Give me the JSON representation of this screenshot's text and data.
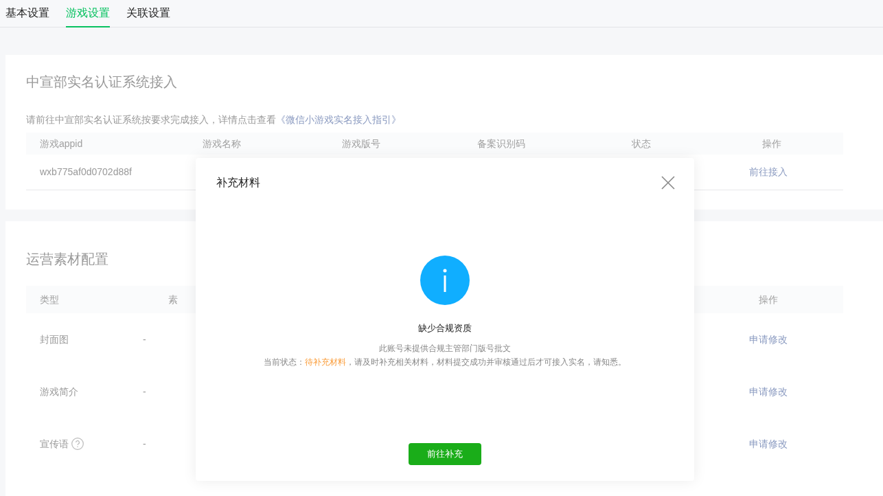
{
  "tabs": [
    {
      "label": "基本设置",
      "selected": false
    },
    {
      "label": "游戏设置",
      "selected": true
    },
    {
      "label": "关联设置",
      "selected": false
    }
  ],
  "realname": {
    "title": "中宣部实名认证系统接入",
    "notice": "请前往中宣部实名认证系统按要求完成接入，详情点击查看",
    "notice_link": "《微信小游戏实名接入指引》",
    "columns": [
      "游戏appid",
      "游戏名称",
      "游戏版号",
      "备案识别码",
      "状态",
      "操作"
    ],
    "rows": [
      {
        "appid": "wxb775af0d0702d88f",
        "action": "前往接入"
      }
    ]
  },
  "materials": {
    "title": "运营素材配置",
    "columns": [
      "类型",
      "素"
    ],
    "action_column": "操作",
    "rows": [
      {
        "type": "封面图",
        "help": false,
        "value": "-",
        "action": "申请修改"
      },
      {
        "type": "游戏简介",
        "help": false,
        "value": "-",
        "action": "申请修改"
      },
      {
        "type": "宣传语",
        "help": true,
        "value": "-",
        "action": "申请修改"
      }
    ]
  },
  "dialog": {
    "title": "补充材料",
    "heading": "缺少合规资质",
    "message": "此账号未提供合规主管部门版号批文",
    "status_label": "当前状态：",
    "status_value": "待补充材料",
    "status_rest": "，请及时补充相关材料，材料提交成功并审核通过后才可接入实名，请知悉。",
    "button": "前往补充"
  }
}
